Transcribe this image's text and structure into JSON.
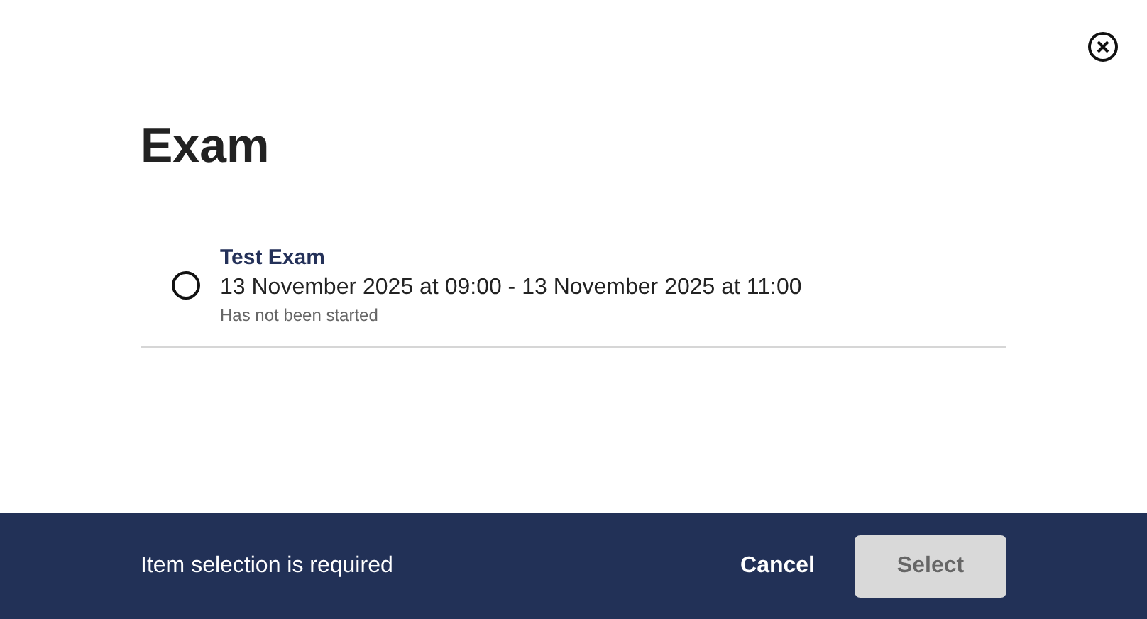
{
  "dialog": {
    "title": "Exam"
  },
  "items": [
    {
      "title": "Test Exam",
      "dates": "13 November 2025 at 09:00 - 13 November 2025 at 11:00",
      "status": "Has not been started",
      "selected": false
    }
  ],
  "footer": {
    "message": "Item selection is required",
    "cancel": "Cancel",
    "select": {
      "label": "Select",
      "disabled": true
    }
  }
}
